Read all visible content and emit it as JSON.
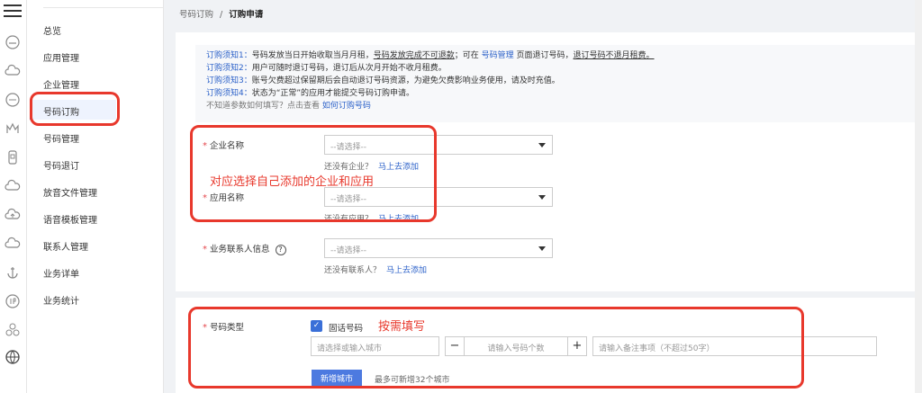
{
  "sidebar": {
    "items": [
      {
        "label": "总览"
      },
      {
        "label": "应用管理"
      },
      {
        "label": "企业管理"
      },
      {
        "label": "号码订购"
      },
      {
        "label": "号码管理"
      },
      {
        "label": "号码退订"
      },
      {
        "label": "放音文件管理"
      },
      {
        "label": "语音模板管理"
      },
      {
        "label": "联系人管理"
      },
      {
        "label": "业务详单"
      },
      {
        "label": "业务统计"
      }
    ]
  },
  "breadcrumb": {
    "parent": "号码订购",
    "sep": "/",
    "current": "订购申请"
  },
  "notice": {
    "l1_key": "订购须知1：",
    "l1_a": "号码发放当日开始收取当月月租，",
    "l1_u": "号码发放完成不可退款",
    "l1_b": "；可在 ",
    "l1_link": "号码管理",
    "l1_c": " 页面退订号码，",
    "l1_u2": "退订号码不退月租费。",
    "l2_key": "订购须知2：",
    "l2": "用户可随时退订号码，退订后从次月开始不收月租费。",
    "l3_key": "订购须知3：",
    "l3": "账号欠费超过保留期后会自动退订号码资源，为避免欠费影响业务使用，请及时充值。",
    "l4_key": "订购须知4：",
    "l4": "状态为“正常”的应用才能提交号码订购申请。",
    "tip": "不知道参数如何填写？点击查看",
    "tip_link": "如何订购号码"
  },
  "form": {
    "enterprise": {
      "label": "企业名称",
      "placeholder": "--请选择--",
      "hint": "还没有企业？",
      "link": "马上去添加"
    },
    "app": {
      "label": "应用名称",
      "placeholder": "--请选择--",
      "hint": "还没有应用？",
      "link": "马上去添加"
    },
    "contact": {
      "label": "业务联系人信息",
      "help": "?",
      "placeholder": "--请选择--",
      "hint": "还没有联系人？",
      "link": "马上去添加"
    },
    "number_type": {
      "label": "号码类型",
      "option": "固话号码",
      "checked": true
    },
    "city": {
      "placeholder": "请选择或输入城市"
    },
    "count": {
      "placeholder": "请输入号码个数",
      "minus": "−",
      "plus": "+"
    },
    "remark": {
      "placeholder": "请输入备注事项（不超过50字）"
    },
    "add_city_button": "新增城市",
    "add_city_hint": "最多可新增32个城市"
  },
  "annotations": {
    "a1": "对应选择自己添加的企业和应用",
    "a2": "按需填写"
  },
  "colors": {
    "accent": "#3a6fd8",
    "annotation": "#e8382c",
    "link": "#2d62c9"
  }
}
